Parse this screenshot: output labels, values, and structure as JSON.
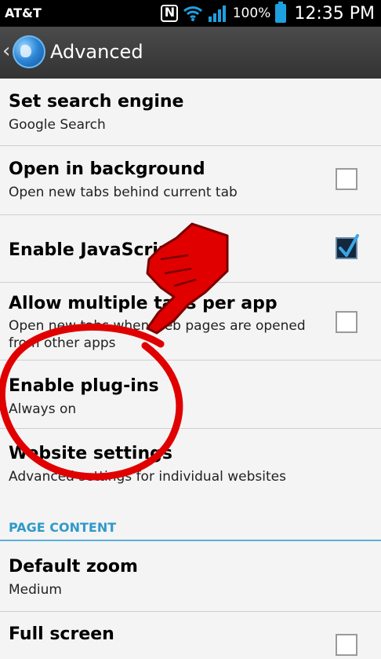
{
  "status_bar": {
    "carrier": "AT&T",
    "battery": "100%",
    "time": "12:35 PM"
  },
  "action_bar": {
    "title": "Advanced"
  },
  "settings": [
    {
      "title": "Set search engine",
      "summary": "Google Search"
    },
    {
      "title": "Open in background",
      "summary": "Open new tabs behind current tab",
      "checked": false
    },
    {
      "title": "Enable JavaScript",
      "checked": true
    },
    {
      "title": "Allow multiple tabs per app",
      "summary": "Open new tabs when web pages are opened from other apps",
      "checked": false
    },
    {
      "title": "Enable plug-ins",
      "summary": "Always on"
    },
    {
      "title": "Website settings",
      "summary": "Advanced settings for individual websites"
    }
  ],
  "section_header": "PAGE CONTENT",
  "page_content": [
    {
      "title": "Default zoom",
      "summary": "Medium"
    },
    {
      "title": "Full screen",
      "checked": false
    }
  ],
  "annotation": {
    "highlight_color": "#e00000",
    "icons": [
      "pointing-hand-icon",
      "red-circle-highlight"
    ]
  }
}
